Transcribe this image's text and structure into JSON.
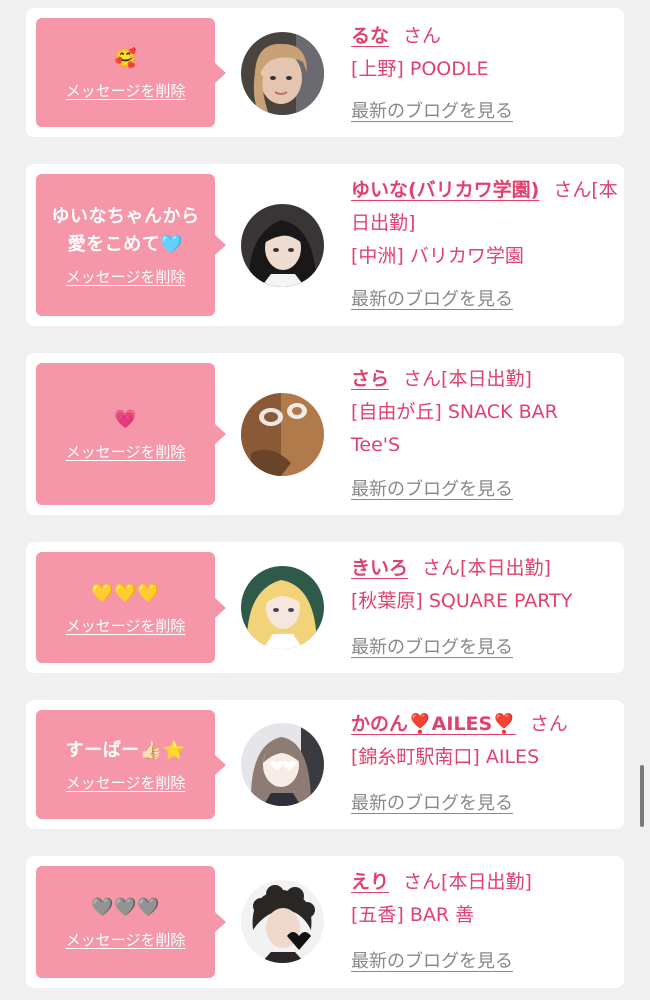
{
  "cards": [
    {
      "message": "🥰",
      "delete_label": "メッセージを削除",
      "name": "るな",
      "san": "さん",
      "badge": "",
      "area": "[上野]",
      "shop": "POODLE",
      "blog_label": "最新のブログを見る",
      "avatar_icon": "cast-photo-icon"
    },
    {
      "message": "ゆいなちゃんから愛をこめて🩵",
      "delete_label": "メッセージを削除",
      "name": "ゆいな(バリカワ学園)",
      "san": "さん",
      "badge": "[本日出勤]",
      "area": "[中洲]",
      "shop": "バリカワ学園",
      "blog_label": "最新のブログを見る",
      "avatar_icon": "cast-photo-icon"
    },
    {
      "message": "💗",
      "delete_label": "メッセージを削除",
      "name": "さら",
      "san": "さん",
      "badge": "[本日出勤]",
      "area": "[自由が丘]",
      "shop": "SNACK BAR Tee'S",
      "blog_label": "最新のブログを見る",
      "avatar_icon": "cast-photo-icon"
    },
    {
      "message": "💛💛💛",
      "delete_label": "メッセージを削除",
      "name": "きいろ",
      "san": "さん",
      "badge": "[本日出勤]",
      "area": "[秋葉原]",
      "shop": "SQUARE PARTY",
      "blog_label": "最新のブログを見る",
      "avatar_icon": "cast-photo-icon"
    },
    {
      "message": "すーぱー👍🏻⭐️",
      "delete_label": "メッセージを削除",
      "name": "かのん❣️AILES❣️",
      "san": "さん",
      "badge": "",
      "area": "[錦糸町駅南口]",
      "shop": "AILES",
      "blog_label": "最新のブログを見る",
      "avatar_icon": "cast-photo-icon"
    },
    {
      "message": "🩶🩶🩶",
      "delete_label": "メッセージを削除",
      "name": "えり",
      "san": "さん",
      "badge": "[本日出勤]",
      "area": "[五香]",
      "shop": "BAR 善",
      "blog_label": "最新のブログを見る",
      "avatar_icon": "cast-photo-icon"
    }
  ],
  "colors": {
    "pink_accent": "#e0416f",
    "bubble_bg": "#f697a9",
    "page_bg": "#f0f0f0",
    "link_gray": "#888888"
  }
}
